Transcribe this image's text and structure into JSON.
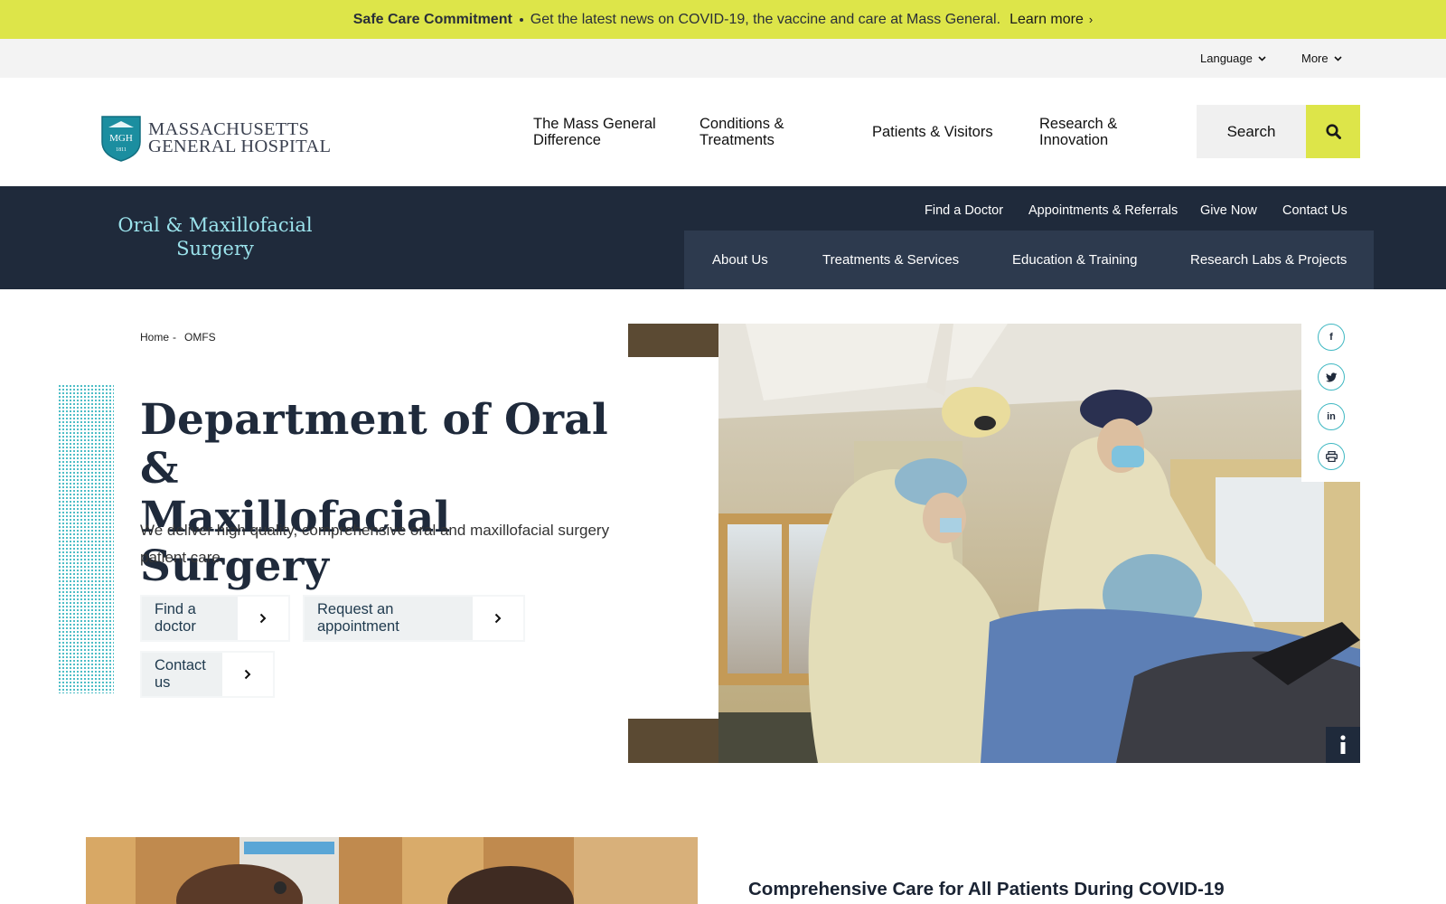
{
  "alert": {
    "title": "Safe Care Commitment",
    "message": "Get the latest news on COVID-19, the vaccine and care at Mass General.",
    "link": "Learn more",
    "link_chevron": "›"
  },
  "utility": {
    "language": "Language",
    "more": "More"
  },
  "logo": {
    "line1": "MASSACHUSETTS",
    "line2": "GENERAL HOSPITAL",
    "shield_initials": "MGH",
    "shield_year": "1811"
  },
  "mainnav": [
    {
      "line1": "The Mass General",
      "line2": "Difference"
    },
    {
      "line1": "Conditions &",
      "line2": "Treatments"
    },
    {
      "line1": "Patients & Visitors",
      "line2": ""
    },
    {
      "line1": "Research &",
      "line2": "Innovation"
    }
  ],
  "search": {
    "label": "Search",
    "icon": "search-icon"
  },
  "dept": {
    "name_line1": "Oral & Maxillofacial",
    "name_line2": "Surgery",
    "toplinks": [
      "Find a Doctor",
      "Appointments & Referrals",
      "Give Now",
      "Contact Us"
    ],
    "subnav": [
      "About Us",
      "Treatments & Services",
      "Education & Training",
      "Research Labs & Projects"
    ]
  },
  "breadcrumb": {
    "home": "Home",
    "separator": "-",
    "current": "OMFS"
  },
  "hero": {
    "title_line1": "Department of Oral &",
    "title_line2": "Maxillofacial Surgery",
    "description": "We deliver high quality, comprehensive oral and maxillofacial surgery patient care.",
    "cta": [
      "Find a doctor",
      "Request an appointment",
      "Contact us"
    ]
  },
  "share": {
    "facebook": "f",
    "linkedin": "in"
  },
  "lower": {
    "title": "Comprehensive Care for All Patients During COVID-19"
  },
  "colors": {
    "accent_yellow": "#dde549",
    "navy": "#1f2a3b",
    "teal": "#3fb8c2"
  }
}
